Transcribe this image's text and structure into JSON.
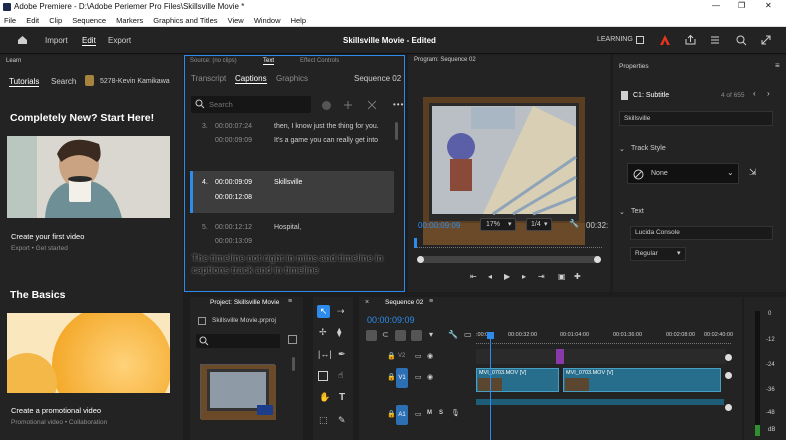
{
  "window": {
    "title": "Adobe Premiere - D:\\Adobe Periemer Pro Files\\Skillsville Movie *",
    "controls": {
      "minimize": "—",
      "restore": "❐",
      "close": "✕"
    }
  },
  "menu": [
    "File",
    "Edit",
    "Clip",
    "Sequence",
    "Markers",
    "Graphics and Titles",
    "View",
    "Window",
    "Help"
  ],
  "header": {
    "tabs": [
      "Import",
      "Edit",
      "Export"
    ],
    "active_tab": "Edit",
    "project_title": "Skillsville Movie - Edited",
    "learning_label": "LEARNING"
  },
  "learn": {
    "header": "Learn",
    "tabs": [
      "Tutorials",
      "Search"
    ],
    "user": "5278-Kevin Kamikawa",
    "section1": "Completely New? Start Here!",
    "card1_title": "Create your first video",
    "card1_meta": "Export  •  Get started",
    "section2": "The Basics",
    "card2_title": "Create a promotional video",
    "card2_meta": "Promotional video  •  Collaboration"
  },
  "captions": {
    "top_tabs": [
      "Source: (no clips)",
      "Text",
      "Effect Controls"
    ],
    "sub_tabs": [
      "Transcript",
      "Captions",
      "Graphics"
    ],
    "sequence": "Sequence 02",
    "search_placeholder": "Search",
    "rows": [
      {
        "num": "3.",
        "in": "00:00:07:24",
        "out": "00:00:09:09",
        "text1": "then, I know just the thing for you.",
        "text2": "It's a game you can really get into"
      },
      {
        "num": "4.",
        "in": "00:00:09:09",
        "out": "00:00:12:08",
        "text1": "Skillsville",
        "text2": ""
      },
      {
        "num": "5.",
        "in": "00:00:12:12",
        "out": "00:00:13:09",
        "text1": "Hospital,",
        "text2": ""
      }
    ],
    "annotation": "The timeline not right in mins and timeline in captions track and in timeline"
  },
  "program": {
    "title": "Program: Sequence 02",
    "timecode": "00:00:09:09",
    "zoom": "17%",
    "resolution": "1/4",
    "end_time": "00:32:"
  },
  "properties": {
    "title": "Properties",
    "item_name": "C1: Subtitle",
    "item_count": "4 of 655",
    "text_field": "Skillsville",
    "track_style_label": "Track Style",
    "track_style_value": "None",
    "text_label": "Text",
    "font": "Lucida Console",
    "weight": "Regular"
  },
  "project": {
    "title": "Project: Skillsville Movie",
    "file": "Skillsville Movie.prproj"
  },
  "timeline": {
    "title": "Sequence 02",
    "timecode": "00:00:09:09",
    "ruler": [
      ":00:00",
      "00:00:32:00",
      "00:01:04:00",
      "00:01:36:00",
      "00:02:08:00",
      "00:02:40:00"
    ],
    "tracks": [
      "V2",
      "V1",
      "A1"
    ],
    "clips": [
      {
        "name": "MVI_0703.MOV [V]"
      },
      {
        "name": "MVI_0703.MOV [V]"
      }
    ]
  },
  "meter": {
    "labels": [
      "0",
      "-12",
      "-24",
      "-36",
      "-48",
      "dB"
    ]
  }
}
